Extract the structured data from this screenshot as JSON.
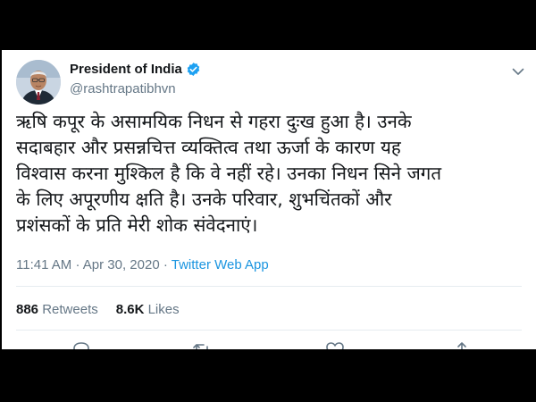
{
  "tweet": {
    "display_name": "President of India",
    "handle": "@rashtrapatibhvn",
    "text": "ऋषि कपूर के असामयिक निधन से गहरा दुःख हुआ है। उनके\nसदाबहार और प्रसन्नचित्त व्यक्तित्व तथा ऊर्जा के कारण यह\nविश्वास करना मुश्किल है कि वे नहीं रहे। उनका निधन सिने जगत\nके लिए अपूरणीय क्षति है। उनके परिवार, शुभचिंतकों और\nप्रशंसकों के प्रति मेरी शोक संवेदनाएं।",
    "time": "11:41 AM",
    "separator": "·",
    "date": "Apr 30, 2020",
    "source": "Twitter Web App",
    "retweets_count": "886",
    "retweets_label": "Retweets",
    "likes_count": "8.6K",
    "likes_label": "Likes"
  },
  "icons": {
    "verified": "verified-badge-icon",
    "more": "chevron-down-icon",
    "actions": [
      "reply-icon",
      "retweet-icon",
      "like-icon",
      "share-icon"
    ]
  },
  "colors": {
    "link": "#1b95e0",
    "secondary_text": "#657786",
    "primary_text": "#14171a",
    "verified": "#1da1f2"
  }
}
